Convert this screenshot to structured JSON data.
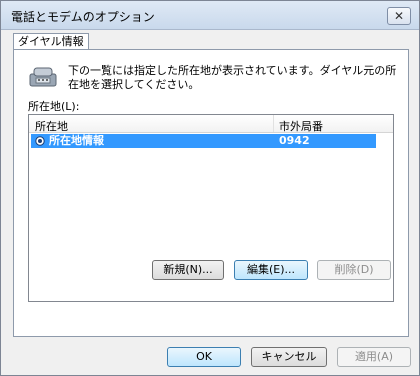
{
  "window": {
    "title": "電話とモデムのオプション",
    "close_glyph": "✕"
  },
  "tabs": [
    {
      "label": "ダイヤル情報"
    }
  ],
  "panel": {
    "description": "下の一覧には指定した所在地が表示されています。ダイヤル元の所在地を選択してください。",
    "locations_label": "所在地(L):"
  },
  "list": {
    "columns": [
      "所在地",
      "市外局番"
    ],
    "rows": [
      {
        "name": "所在地情報",
        "area_code": "0942",
        "selected": true
      }
    ]
  },
  "panel_buttons": {
    "new": "新規(N)...",
    "edit": "編集(E)...",
    "delete": "削除(D)"
  },
  "dialog_buttons": {
    "ok": "OK",
    "cancel": "キャンセル",
    "apply": "適用(A)"
  },
  "icons": {
    "phone": "phone-modem-icon",
    "location": "location-radio-icon"
  },
  "colors": {
    "selection": "#3399ff",
    "titlebar": "#c9d9ec"
  }
}
